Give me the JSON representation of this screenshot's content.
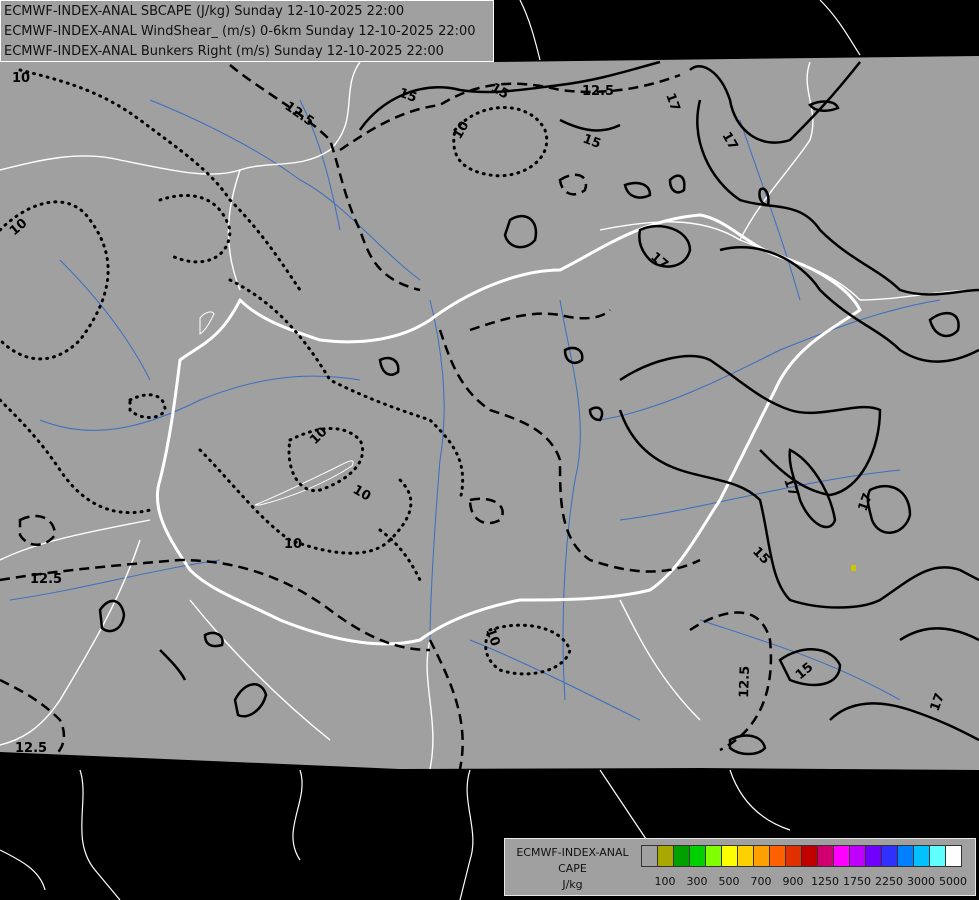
{
  "titles": [
    "ECMWF-INDEX-ANAL SBCAPE (J/kg) Sunday 12-10-2025 22:00",
    "ECMWF-INDEX-ANAL WindShear_ (m/s) 0-6km Sunday 12-10-2025 22:00",
    "ECMWF-INDEX-ANAL Bunkers Right (m/s) Sunday 12-10-2025 22:00"
  ],
  "legend": {
    "title_lines": [
      "ECMWF-INDEX-ANAL",
      "CAPE",
      "J/kg"
    ],
    "colors": [
      "#a0a0a0",
      "#a8a800",
      "#00a000",
      "#00d000",
      "#80ff00",
      "#ffff00",
      "#ffd000",
      "#ffa000",
      "#ff6000",
      "#e03000",
      "#c00000",
      "#d00070",
      "#ff00ff",
      "#c000ff",
      "#7000ff",
      "#3030ff",
      "#0080ff",
      "#00c0ff",
      "#60ffff",
      "#ffffff"
    ],
    "tick_labels": [
      "100",
      "300",
      "500",
      "700",
      "900",
      "1250",
      "1750",
      "2250",
      "3000",
      "5000"
    ]
  },
  "contour_labels": {
    "dotted": [
      "10",
      "10",
      "10",
      "10",
      "10",
      "10",
      "10"
    ],
    "dashed": [
      "12.5",
      "12.5",
      "12.5",
      "12.5",
      "12.5"
    ],
    "solid": [
      "15",
      "15",
      "15",
      "15",
      "15",
      "17",
      "17",
      "17",
      "17",
      "17"
    ]
  },
  "colors": {
    "domain_fill": "#a0a0a0",
    "outside": "#000000",
    "border": "#ffffff",
    "river": "#3a6ec0",
    "contour": "#000000"
  }
}
